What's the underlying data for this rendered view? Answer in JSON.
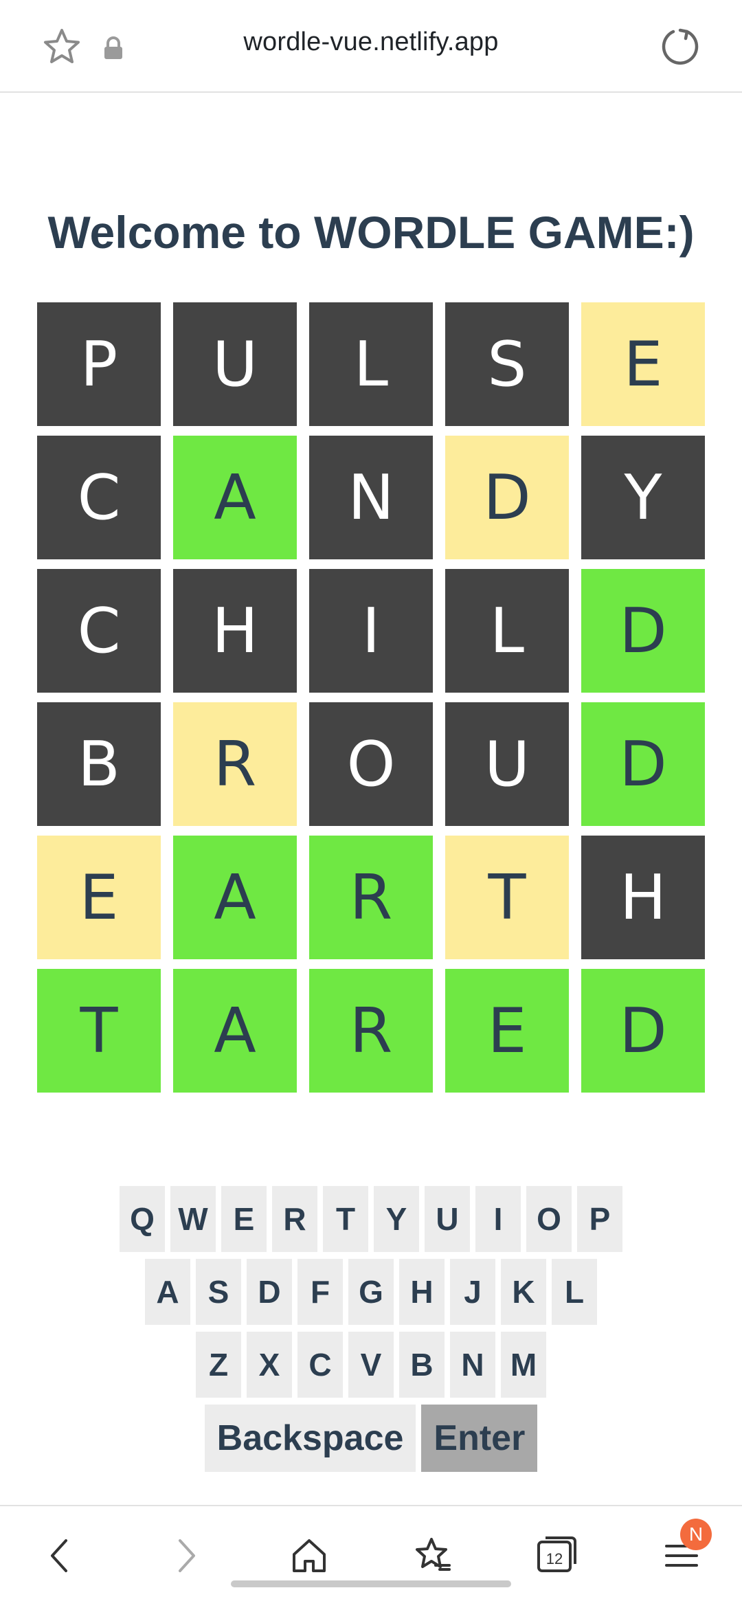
{
  "browser": {
    "url": "wordle-vue.netlify.app"
  },
  "title": "Welcome to WORDLE GAME:)",
  "board": [
    [
      {
        "l": "P",
        "s": "absent"
      },
      {
        "l": "U",
        "s": "absent"
      },
      {
        "l": "L",
        "s": "absent"
      },
      {
        "l": "S",
        "s": "absent"
      },
      {
        "l": "E",
        "s": "present"
      }
    ],
    [
      {
        "l": "C",
        "s": "absent"
      },
      {
        "l": "A",
        "s": "correct"
      },
      {
        "l": "N",
        "s": "absent"
      },
      {
        "l": "D",
        "s": "present"
      },
      {
        "l": "Y",
        "s": "absent"
      }
    ],
    [
      {
        "l": "C",
        "s": "absent"
      },
      {
        "l": "H",
        "s": "absent"
      },
      {
        "l": "I",
        "s": "absent"
      },
      {
        "l": "L",
        "s": "absent"
      },
      {
        "l": "D",
        "s": "correct"
      }
    ],
    [
      {
        "l": "B",
        "s": "absent"
      },
      {
        "l": "R",
        "s": "present"
      },
      {
        "l": "O",
        "s": "absent"
      },
      {
        "l": "U",
        "s": "absent"
      },
      {
        "l": "D",
        "s": "correct"
      }
    ],
    [
      {
        "l": "E",
        "s": "present"
      },
      {
        "l": "A",
        "s": "correct"
      },
      {
        "l": "R",
        "s": "correct"
      },
      {
        "l": "T",
        "s": "present"
      },
      {
        "l": "H",
        "s": "absent"
      }
    ],
    [
      {
        "l": "T",
        "s": "correct"
      },
      {
        "l": "A",
        "s": "correct"
      },
      {
        "l": "R",
        "s": "correct"
      },
      {
        "l": "E",
        "s": "correct"
      },
      {
        "l": "D",
        "s": "correct"
      }
    ]
  ],
  "keyboard": {
    "rows": [
      [
        "Q",
        "W",
        "E",
        "R",
        "T",
        "Y",
        "U",
        "I",
        "O",
        "P"
      ],
      [
        "A",
        "S",
        "D",
        "F",
        "G",
        "H",
        "J",
        "K",
        "L"
      ],
      [
        "Z",
        "X",
        "C",
        "V",
        "B",
        "N",
        "M"
      ]
    ],
    "backspace": "Backspace",
    "enter": "Enter"
  },
  "bottom_nav": {
    "tab_count": "12",
    "badge": "N"
  },
  "colors": {
    "absent": "#444444",
    "present": "#fdec9b",
    "correct": "#6fe843",
    "text": "#2c3e50",
    "key": "#ececec",
    "enter": "#a8a8a8"
  },
  "icons": [
    "star-icon",
    "lock-icon",
    "reload-icon",
    "back-icon",
    "forward-icon",
    "home-icon",
    "bookmarks-icon",
    "tabs-icon",
    "menu-icon"
  ]
}
